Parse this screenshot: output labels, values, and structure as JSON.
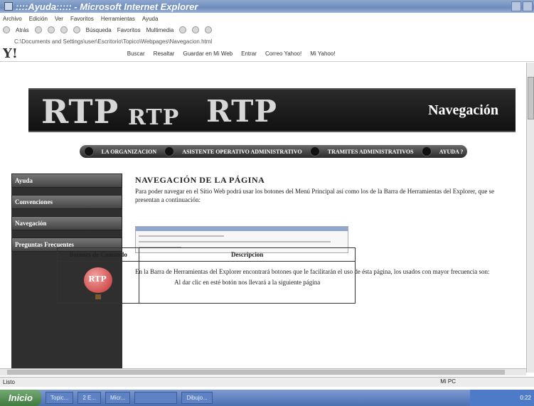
{
  "window": {
    "title": "::::Ayuda::::: - Microsoft Internet Explorer"
  },
  "menubar": [
    "Archivo",
    "Edición",
    "Ver",
    "Favoritos",
    "Herramientas",
    "Ayuda"
  ],
  "toolbar": {
    "back": "Atrás",
    "search": "Búsqueda",
    "favorites": "Favoritos",
    "multimedia": "Multimedia"
  },
  "address": {
    "path": "C:\\Documents and Settings\\user\\Escritorio\\Topico\\Webpages\\Navegacion.html"
  },
  "yahoo_bar": {
    "logo": "Y!",
    "search": "Buscar",
    "highlight": "Resaltar",
    "save": "Guardar en Mi Web",
    "enter": "Entrar",
    "mail": "Correo Yahoo!",
    "my_yahoo": "Mi Yahoo!"
  },
  "banner": {
    "logo_text": "RTP",
    "section_title": "Navegación"
  },
  "nav": [
    "LA ORGANIZACION",
    "ASISTENTE OPERATIVO ADMINISTRATIVO",
    "TRAMITES ADMINISTRATIVOS",
    "AYUDA ?"
  ],
  "sidebar": [
    "Ayuda",
    "Convenciones",
    "Navegación",
    "Preguntas Frecuentes"
  ],
  "content": {
    "heading": "NAVEGACIÓN DE LA PÁGINA",
    "intro": "Para poder navegar en el Sitio Web podrá usar los botones del Menú Principal así como los de la Barra de Herramientas del Explorer, que se presentan a continuación:",
    "toolbar_text": "En la Barra de Herramientas del Explorer encontrará botones que le facilitarán el uso de ésta página, los usados con mayor frecuencia son:",
    "table": {
      "headers": [
        "Botones de Comando",
        "Descripcion"
      ],
      "row1_desc": "Al dar clic en esté botón nos llevará a la siguiente página"
    }
  },
  "status": {
    "left": "Listo",
    "zone": "Mi PC"
  },
  "taskbar": {
    "start": "Inicio",
    "tasks": [
      "Topic...",
      "2 E...",
      "Micr...",
      "Dibujo..."
    ],
    "clock": "0:22"
  }
}
